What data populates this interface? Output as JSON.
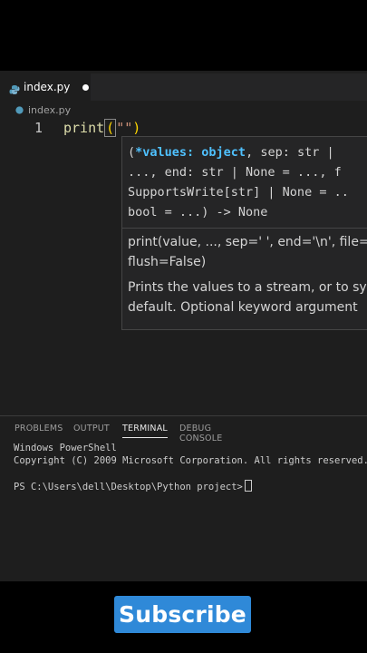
{
  "editor": {
    "tab": {
      "label": "index.py"
    },
    "breadcrumb": "index.py",
    "line_number": "1",
    "code": {
      "func": "print",
      "open": "(",
      "quote": "\"\"",
      "close": ")"
    }
  },
  "hover": {
    "signature_highlight": "*values: object",
    "signature_line1_rest": ", sep: str |",
    "signature_line2": "..., end: str | None = ..., f",
    "signature_line3": "SupportsWrite[str] | None = ..",
    "signature_line4": "bool = ...) -> None",
    "doc_line1": "print(value, ..., sep=' ', end='\\n', file=",
    "doc_line2": "flush=False)",
    "desc_line1": "Prints the values to a stream, or to sy",
    "desc_line2": "default. Optional keyword argument"
  },
  "panel": {
    "tabs": [
      "PROBLEMS",
      "OUTPUT",
      "TERMINAL",
      "DEBUG CONSOLE"
    ],
    "active_tab": "TERMINAL",
    "terminal": {
      "line1": "Windows PowerShell",
      "line2": "Copyright (C) 2009 Microsoft Corporation. All rights reserved.",
      "prompt": "PS C:\\Users\\dell\\Desktop\\Python project>"
    }
  },
  "overlay": {
    "subscribe_label": "Subscribe"
  },
  "colors": {
    "accent": "#2f89d8",
    "editor_bg": "#1e1e1e",
    "function": "#dcdcaa",
    "param": "#4fc1ff"
  }
}
